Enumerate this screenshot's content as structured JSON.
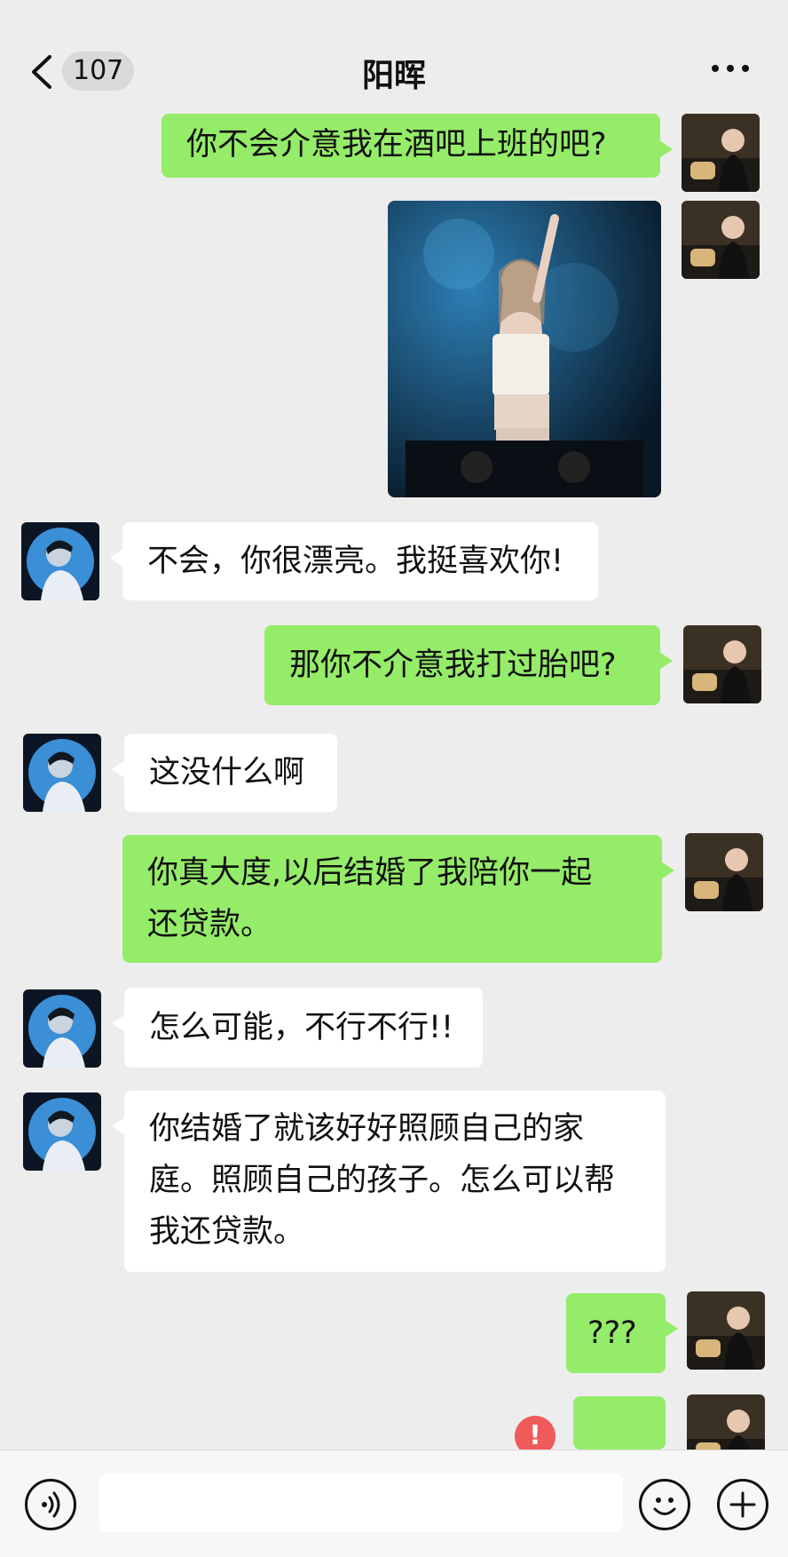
{
  "header": {
    "back_count": "107",
    "title": "阳晖"
  },
  "messages": [
    {
      "id": "m1",
      "sender": "me",
      "type": "text",
      "text": "你不会介意我在酒吧上班的吧?"
    },
    {
      "id": "m2",
      "sender": "me",
      "type": "image",
      "image_description": "photo of a woman DJ in a nightclub"
    },
    {
      "id": "m3",
      "sender": "them",
      "type": "text",
      "text": "不会，你很漂亮。我挺喜欢你!"
    },
    {
      "id": "m4",
      "sender": "me",
      "type": "text",
      "text": "那你不介意我打过胎吧?"
    },
    {
      "id": "m5",
      "sender": "them",
      "type": "text",
      "text": "这没什么啊"
    },
    {
      "id": "m6",
      "sender": "me",
      "type": "text",
      "text": "你真大度,以后结婚了我陪你一起\n还贷款。"
    },
    {
      "id": "m7",
      "sender": "them",
      "type": "text",
      "text": "怎么可能，不行不行!!"
    },
    {
      "id": "m8",
      "sender": "them",
      "type": "text",
      "text": "你结婚了就该好好照顾自己的家\n庭。照顾自己的孩子。怎么可以帮\n我还贷款。"
    },
    {
      "id": "m9",
      "sender": "me",
      "type": "text",
      "text": "???"
    },
    {
      "id": "m10",
      "sender": "me",
      "type": "emoji",
      "emoji": "🤭",
      "status": "send-failed"
    }
  ],
  "error_mark": "!",
  "colors": {
    "background": "#ededed",
    "my_bubble": "#95ec69",
    "their_bubble": "#ffffff",
    "error": "#f05a5a"
  },
  "icons": {
    "back": "chevron-left-icon",
    "more": "more-dots-icon",
    "voice": "voice-icon",
    "emoji": "emoji-icon",
    "add": "plus-icon"
  }
}
